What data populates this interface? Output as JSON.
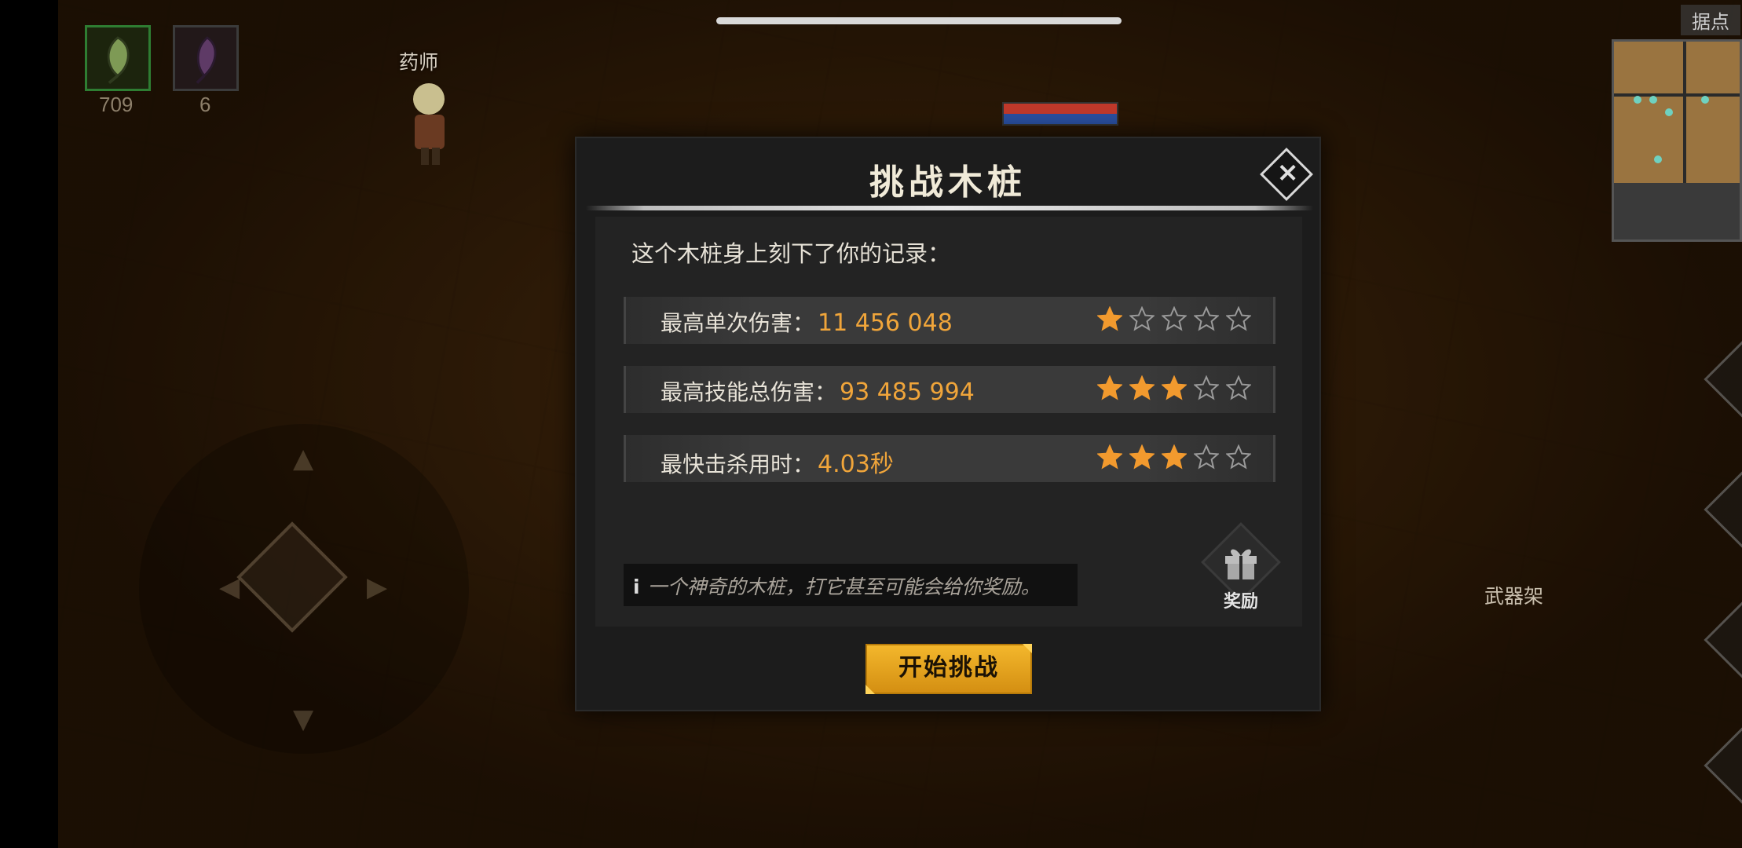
{
  "hud": {
    "items": [
      {
        "icon": "green-herb-icon",
        "count": "709"
      },
      {
        "icon": "purple-herb-icon",
        "count": "6"
      }
    ],
    "npc_label": "药师",
    "minimap_label": "据点",
    "weapon_rack_label": "武器架"
  },
  "dialog": {
    "title": "挑战木桩",
    "intro": "这个木桩身上刻下了你的记录：",
    "records": [
      {
        "label": "最高单次伤害：",
        "value": "11 456 048",
        "stars": 1,
        "max_stars": 5
      },
      {
        "label": "最高技能总伤害：",
        "value": "93 485 994",
        "stars": 3,
        "max_stars": 5
      },
      {
        "label": "最快击杀用时：",
        "value": "4.03秒",
        "stars": 3,
        "max_stars": 5
      }
    ],
    "hint": "一个神奇的木桩，打它甚至可能会给你奖励。",
    "hint_icon": "i",
    "reward_label": "奖励",
    "start_button": "开始挑战",
    "close_icon": "×"
  },
  "colors": {
    "accent_orange": "#f0a53a",
    "star_filled": "#f29a2e",
    "button_gold": "#f3b72c"
  }
}
